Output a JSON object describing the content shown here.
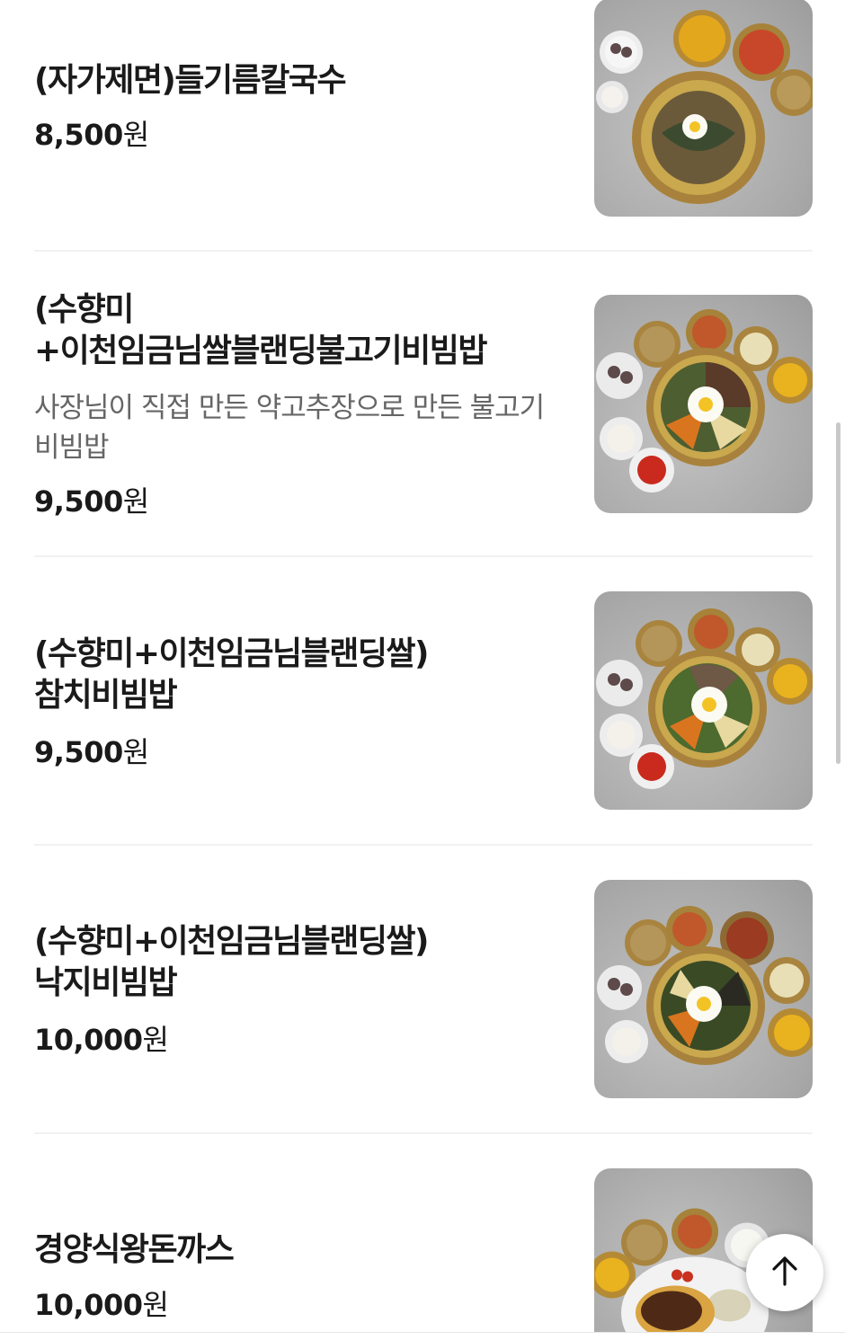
{
  "menu": {
    "items": [
      {
        "name": "(자가제면)들기름칼국수",
        "description": "",
        "price": "8,500",
        "currency": "원",
        "photo": "noodle-set-photo"
      },
      {
        "name": "(수향미+이천임금님쌀블랜딩불고기비빔밥",
        "description": "사장님이 직접 만든 약고추장으로 만든 불고기비빔밥",
        "price": "9,500",
        "currency": "원",
        "photo": "bibimbap-set-photo"
      },
      {
        "name": "(수향미+이천임금님블랜딩쌀)참치비빔밥",
        "description": "",
        "price": "9,500",
        "currency": "원",
        "photo": "bibimbap-set-photo"
      },
      {
        "name": "(수향미+이천임금님블랜딩쌀)낙지비빔밥",
        "description": "",
        "price": "10,000",
        "currency": "원",
        "photo": "bibimbap-set-photo"
      },
      {
        "name": "경양식왕돈까스",
        "description": "",
        "price": "10,000",
        "currency": "원",
        "photo": "pork-cutlet-set-photo"
      }
    ]
  },
  "scroll_top_button": {
    "icon": "arrow-up-icon"
  },
  "colors": {
    "text": "#1a1a1a",
    "description": "#666666",
    "divider": "#f1f1f1",
    "brass": "#c9a84e"
  }
}
